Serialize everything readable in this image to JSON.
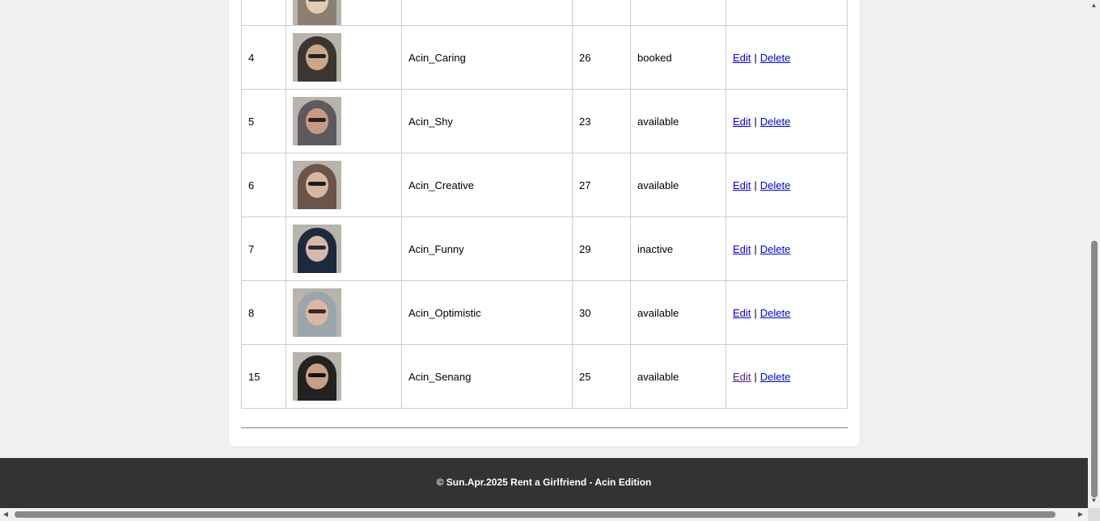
{
  "table": {
    "rows": [
      {
        "id": "",
        "name": "",
        "age": "",
        "status": "",
        "photo_colors": {
          "hijab": "#8a7f70",
          "face": "#e5cbb3",
          "eyes": "#444"
        }
      },
      {
        "id": "4",
        "name": "Acin_Caring",
        "age": "26",
        "status": "booked",
        "photo_colors": {
          "hijab": "#3b3631",
          "face": "#c9a88a",
          "eyes": "#222"
        },
        "edit_visited": false
      },
      {
        "id": "5",
        "name": "Acin_Shy",
        "age": "23",
        "status": "available",
        "photo_colors": {
          "hijab": "#5d5a5f",
          "face": "#c89a85",
          "eyes": "#2a1f1c"
        },
        "edit_visited": false
      },
      {
        "id": "6",
        "name": "Acin_Creative",
        "age": "27",
        "status": "available",
        "photo_colors": {
          "hijab": "#6b5448",
          "face": "#d8b7a0",
          "eyes": "#1a1a1a"
        },
        "edit_visited": false
      },
      {
        "id": "7",
        "name": "Acin_Funny",
        "age": "29",
        "status": "inactive",
        "photo_colors": {
          "hijab": "#1c2a3e",
          "face": "#d9b8aa",
          "eyes": "#2b2b2b"
        },
        "edit_visited": false
      },
      {
        "id": "8",
        "name": "Acin_Optimistic",
        "age": "30",
        "status": "available",
        "photo_colors": {
          "hijab": "#9aa6ac",
          "face": "#dcb8a2",
          "eyes": "#3a2a20"
        },
        "edit_visited": false
      },
      {
        "id": "15",
        "name": "Acin_Senang",
        "age": "25",
        "status": "available",
        "photo_colors": {
          "hijab": "#222222",
          "face": "#c79f84",
          "eyes": "#111"
        },
        "edit_visited": true
      }
    ],
    "edit_label": "Edit",
    "separator": "|",
    "delete_label": "Delete"
  },
  "footer": {
    "text": "© Sun.Apr.2025 Rent a Girlfriend - Acin Edition"
  },
  "colors": {
    "link": "#0000ee",
    "link_visited": "#551a8b",
    "footer_bg": "#333333"
  }
}
